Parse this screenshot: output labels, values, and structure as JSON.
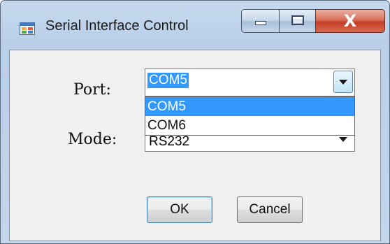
{
  "window": {
    "title": "Serial Interface Control",
    "icon": "app-form-icon"
  },
  "caption": {
    "minimize_icon": "minimize-icon",
    "maximize_icon": "maximize-icon",
    "close_label": "X"
  },
  "port": {
    "label": "Port:",
    "value": "COM5",
    "options": [
      "COM5",
      "COM6"
    ],
    "highlighted_option": "COM5",
    "expanded": true
  },
  "mode": {
    "label": "Mode:",
    "value": "RS232"
  },
  "buttons": {
    "ok_label": "OK",
    "cancel_label": "Cancel"
  },
  "colors": {
    "selection": "#3399ff",
    "close_button": "#c33f27",
    "titlebar": "#b9cfe8",
    "client_bg": "#f0f0f0"
  }
}
